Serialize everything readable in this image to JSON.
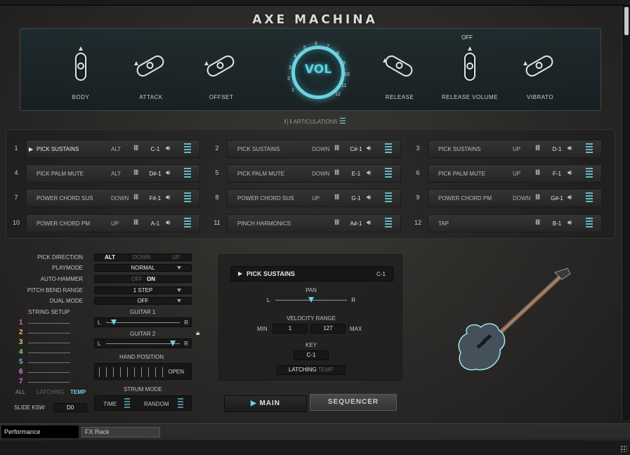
{
  "title": "AXE MACHINA",
  "knobs": {
    "body": "BODY",
    "attack": "ATTACK",
    "offset": "OFFSET",
    "volume": "VOL",
    "release": "RELEASE",
    "release_volume": "RELEASE VOLUME",
    "vibrato": "VIBRATO",
    "release_volume_state": "OFF",
    "volume_scale": [
      "1",
      "2",
      "3",
      "4",
      "5",
      "6",
      "7",
      "8",
      "9",
      "10",
      "11",
      "12"
    ]
  },
  "articulations_label": "ARTICULATIONS",
  "slots": [
    {
      "num": "1",
      "name": "PICK SUSTAINS",
      "mode": "ALT",
      "note": "C-1",
      "selected": true
    },
    {
      "num": "2",
      "name": "PICK SUSTAINS",
      "mode": "DOWN",
      "note": "C#-1"
    },
    {
      "num": "3",
      "name": "PICK SUSTAINS",
      "mode": "UP",
      "note": "D-1"
    },
    {
      "num": "4",
      "name": "PICK PALM MUTE",
      "mode": "ALT",
      "note": "D#-1"
    },
    {
      "num": "5",
      "name": "PICK PALM MUTE",
      "mode": "DOWN",
      "note": "E-1"
    },
    {
      "num": "6",
      "name": "PICK PALM MUTE",
      "mode": "UP",
      "note": "F-1"
    },
    {
      "num": "7",
      "name": "POWER CHORD SUS",
      "mode": "DOWN",
      "note": "F#-1"
    },
    {
      "num": "8",
      "name": "POWER CHORD SUS",
      "mode": "UP",
      "note": "G-1"
    },
    {
      "num": "9",
      "name": "POWER CHORD PM",
      "mode": "DOWN",
      "note": "G#-1"
    },
    {
      "num": "10",
      "name": "POWER CHORD PM",
      "mode": "UP",
      "note": "A-1"
    },
    {
      "num": "11",
      "name": "PINCH HARMONICS",
      "mode": "",
      "note": "A#-1"
    },
    {
      "num": "12",
      "name": "TAP",
      "mode": "",
      "note": "B-1"
    }
  ],
  "settings": {
    "pick_direction": {
      "label": "PICK DIRECTION",
      "options": [
        "ALT",
        "DOWN",
        "UP"
      ],
      "selected": "ALT"
    },
    "playmode": {
      "label": "PLAYMODE",
      "value": "NORMAL"
    },
    "auto_hammer": {
      "label": "AUTO-HAMMER",
      "options": [
        "OFF",
        "ON"
      ],
      "selected": "ON"
    },
    "pitch_bend_range": {
      "label": "PITCH BEND RANGE",
      "value": "1 STEP"
    },
    "dual_mode": {
      "label": "DUAL MODE",
      "value": "OFF"
    }
  },
  "string_setup": {
    "label": "STRING SETUP",
    "strings": [
      {
        "n": "1",
        "color": "#e86a8a"
      },
      {
        "n": "2",
        "color": "#e8c25a"
      },
      {
        "n": "3",
        "color": "#c9d85a"
      },
      {
        "n": "4",
        "color": "#7fd6a0"
      },
      {
        "n": "5",
        "color": "#6fb6e8"
      },
      {
        "n": "6",
        "color": "#c98ae8"
      },
      {
        "n": "7",
        "color": "#e86ad0"
      }
    ],
    "modes": [
      "ALL",
      "LATCHING",
      "TEMP"
    ],
    "selected_mode": "TEMP"
  },
  "guitar1": {
    "label": "GUITAR 1",
    "left": "L",
    "right": "R",
    "pan": 0.1
  },
  "guitar2": {
    "label": "GUITAR 2",
    "left": "L",
    "right": "R",
    "pan": 0.9
  },
  "hand_position": {
    "label": "HAND POSITION",
    "value": "OPEN"
  },
  "strum_mode": {
    "label": "STRUM MODE",
    "time": "TIME",
    "random": "RANDOM"
  },
  "slide_ksw": {
    "label": "SLIDE KSW",
    "value": "D0"
  },
  "detail": {
    "name": "PICK SUSTAINS",
    "note": "C-1",
    "pan_label": "PAN",
    "pan_left": "L",
    "pan_right": "R",
    "pan": 0.5,
    "velocity_label": "VELOCITY RANGE",
    "min_label": "MIN",
    "min": "1",
    "max": "127",
    "max_label": "MAX",
    "key_label": "KEY",
    "key": "C-1",
    "latch_options": [
      "LATCHING",
      "TEMP"
    ],
    "latch_selected": "LATCHING"
  },
  "buttons": {
    "main": "MAIN",
    "sequencer": "SEQUENCER"
  },
  "tabs": {
    "performance": "Performance",
    "fx_rack": "FX Rack"
  },
  "colors": {
    "accent": "#6fd3dd"
  }
}
